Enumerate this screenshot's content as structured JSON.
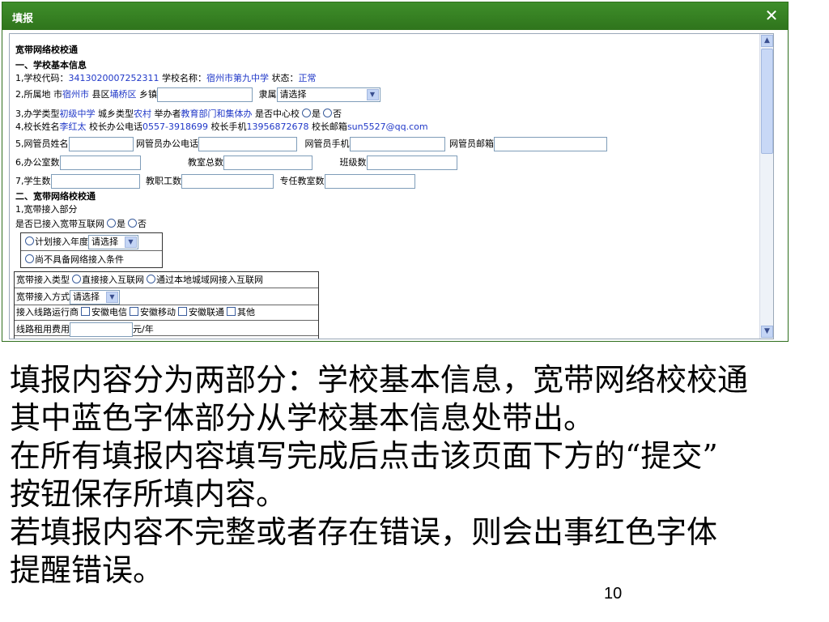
{
  "dialog": {
    "title": "填报",
    "close_glyph": "✕",
    "close_icon": "close-icon"
  },
  "form": {
    "section_title": "宽带网络校校通",
    "part1": "一、学校基本信息",
    "row1": {
      "code_label": "1,学校代码：",
      "code": "3413020007252311",
      "name_label": "学校名称：",
      "name": "宿州市第九中学",
      "status_label": "状态：",
      "status": "正常"
    },
    "row2": {
      "location_label": "2,所属地 市",
      "city": "宿州市",
      "district_label": "县区",
      "district": "埇桥区",
      "town_label": "乡镇",
      "affiliation_label": "隶属",
      "affiliation_select": "请选择"
    },
    "row3": {
      "type_label": "3,办学类型",
      "type": "初级中学",
      "urban_label": "城乡类型",
      "urban": "农村",
      "organizer_label": "举办者",
      "organizer": "教育部门和集体办",
      "center_label": "是否中心校",
      "yes": "是",
      "no": "否"
    },
    "row4": {
      "principal_label": "4,校长姓名",
      "principal": "李红太",
      "office_phone_label": "校长办公电话",
      "office_phone": "0557-3918699",
      "mobile_label": "校长手机",
      "mobile": "13956872678",
      "email_label": "校长邮箱",
      "email": "sun5527@qq.com"
    },
    "row5": {
      "admin_name": "5,网管员姓名",
      "admin_office": "网管员办公电话",
      "admin_mobile": "网管员手机",
      "admin_email": "网管员邮箱"
    },
    "row6": {
      "office_rooms": "6,办公室数",
      "classrooms": "教室总数",
      "classes": "班级数"
    },
    "row7": {
      "students": "7,学生数",
      "staff": "教职工数",
      "dedicated_rooms": "专任教室数"
    },
    "part2": "二、宽带网络校校通",
    "sub1": "1,宽带接入部分",
    "connected_label": "是否已接入宽带互联网",
    "yes": "是",
    "no": "否",
    "plan_label": "计划接入年度",
    "plan_select": "请选择",
    "no_condition": "尚不具备网络接入条件",
    "access_type_label": "宽带接入类型",
    "access_direct": "直接接入互联网",
    "access_local": "通过本地城域网接入互联网",
    "access_mode_label": "宽带接入方式",
    "access_mode_select": "请选择",
    "carrier_label": "接入线路运行商",
    "carriers": [
      "安徽电信",
      "安徽移动",
      "安徽联通",
      "其他"
    ],
    "rent_label": "线路租用费用",
    "rent_unit": "元/年"
  },
  "scroll": {
    "up": "▲",
    "down": "▼"
  },
  "explain": {
    "lines": [
      "填报内容分为两部分：学校基本信息，宽带网络校校通",
      "其中蓝色字体部分从学校基本信息处带出。",
      "在所有填报内容填写完成后点击该页面下方的“提交”",
      "按钮保存所填内容。",
      "若填报内容不完整或者存在错误，则会出事红色字体",
      "提醒错误。"
    ],
    "page_number": "10"
  },
  "colors": {
    "titlebar": "#3e8e2a",
    "prefilled_text": "#2038c8"
  }
}
